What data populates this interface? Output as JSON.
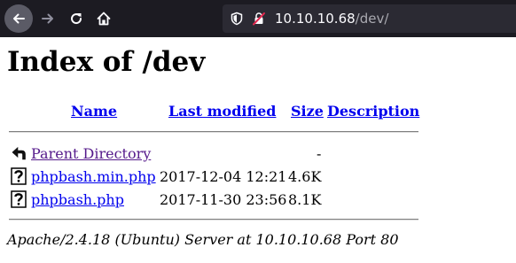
{
  "browser": {
    "url_host": "10.10.10.68",
    "url_path": "/dev/",
    "icons": [
      "back-arrow-icon",
      "forward-arrow-icon",
      "reload-icon",
      "home-icon",
      "tracking-shield-icon",
      "insecure-lock-icon"
    ]
  },
  "page": {
    "title": "Index of /dev",
    "columns": {
      "name": "Name",
      "last_modified": "Last modified",
      "size": "Size",
      "description": "Description"
    },
    "rows": [
      {
        "name": "Parent Directory",
        "modified": "",
        "size": "-",
        "icon": "parent-directory-icon"
      },
      {
        "name": "phpbash.min.php",
        "modified": "2017-12-04 12:21",
        "size": "4.6K",
        "icon": "unknown-file-icon"
      },
      {
        "name": "phpbash.php",
        "modified": "2017-11-30 23:56",
        "size": "8.1K",
        "icon": "unknown-file-icon"
      }
    ],
    "footer": "Apache/2.4.18 (Ubuntu) Server at 10.10.10.68 Port 80"
  },
  "colors": {
    "link": "#0000ee",
    "visited_link": "#551a8b",
    "toolbar_bg": "#1c1b22",
    "urlbar_bg": "#2b2a33"
  }
}
